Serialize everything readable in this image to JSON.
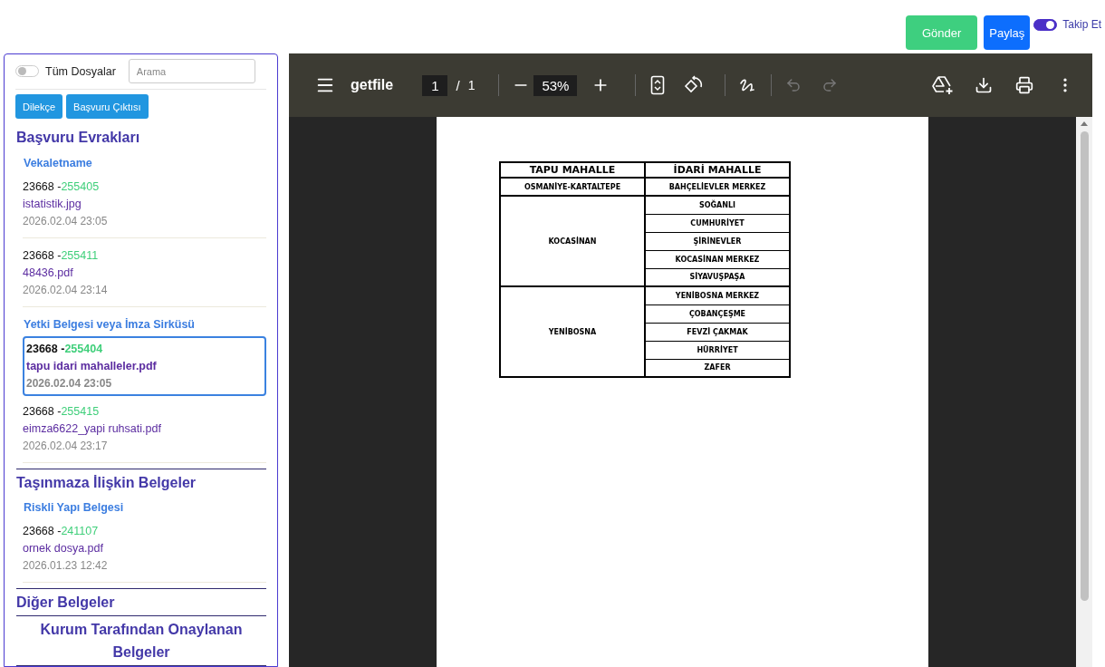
{
  "top_bar": {
    "buttons": [
      {
        "label": "Gönder",
        "kind": "success"
      },
      {
        "label": "Paylaş",
        "kind": "primary"
      }
    ],
    "follow": {
      "label": "Takip Et",
      "on": true
    }
  },
  "sidebar": {
    "all_files": {
      "label": "Tüm Dosyalar",
      "on": false
    },
    "search": {
      "placeholder": "Arama"
    },
    "buttons": [
      "Dilekçe",
      "Başvuru Çıktısı"
    ],
    "sections": [
      {
        "title": "Başvuru Evrakları",
        "centered": false,
        "groups": [
          {
            "title": "Vekaletname",
            "files": [
              {
                "code": "23668 -",
                "id": "255405",
                "name": "istatistik.jpg",
                "date": "2026.02.04 23:05",
                "selected": false
              },
              {
                "code": "23668 -",
                "id": "255411",
                "name": "48436.pdf",
                "date": "2026.02.04 23:14",
                "selected": false
              }
            ]
          },
          {
            "title": "Yetki Belgesi veya İmza Sirküsü",
            "files": [
              {
                "code": "23668 -",
                "id": "255404",
                "name": "tapu idari mahalleler.pdf",
                "date": "2026.02.04 23:05",
                "selected": true
              },
              {
                "code": "23668 -",
                "id": "255415",
                "name": "eimza6622_yapi ruhsati.pdf",
                "date": "2026.02.04 23:17",
                "selected": false
              }
            ]
          }
        ]
      },
      {
        "title": "Taşınmaza İlişkin Belgeler",
        "centered": false,
        "groups": [
          {
            "title": "Riskli Yapı Belgesi",
            "files": [
              {
                "code": "23668 -",
                "id": "241107",
                "name": "ornek dosya.pdf",
                "date": "2026.01.23 12:42",
                "selected": false
              }
            ]
          }
        ]
      },
      {
        "title": "Diğer Belgeler",
        "centered": false
      },
      {
        "title": "Kurum Tarafından Onaylanan Belgeler",
        "centered": true
      }
    ]
  },
  "viewer": {
    "title": "getfile",
    "page": "1",
    "separator": "/",
    "total": "1",
    "zoom": "53%",
    "undo_disabled": true,
    "redo_disabled": true,
    "document": {
      "columns": [
        "TAPU MAHALLE",
        "İDARİ MAHALLE"
      ],
      "rows": [
        {
          "tapu": "OSMANİYE-KARTALTEPE",
          "idari": [
            "BAHÇELİEVLER MERKEZ"
          ]
        },
        {
          "tapu": "KOCASİNAN",
          "idari": [
            "SOĞANLI",
            "CUMHURİYET",
            "ŞİRİNEVLER",
            "KOCASİNAN MERKEZ",
            "SİYAVUŞPAŞA"
          ]
        },
        {
          "tapu": "YENİBOSNA",
          "idari": [
            "YENİBOSNA MERKEZ",
            "ÇOBANÇEŞME",
            "FEVZİ ÇAKMAK",
            "HÜRRİYET",
            "ZAFER"
          ]
        }
      ]
    }
  }
}
